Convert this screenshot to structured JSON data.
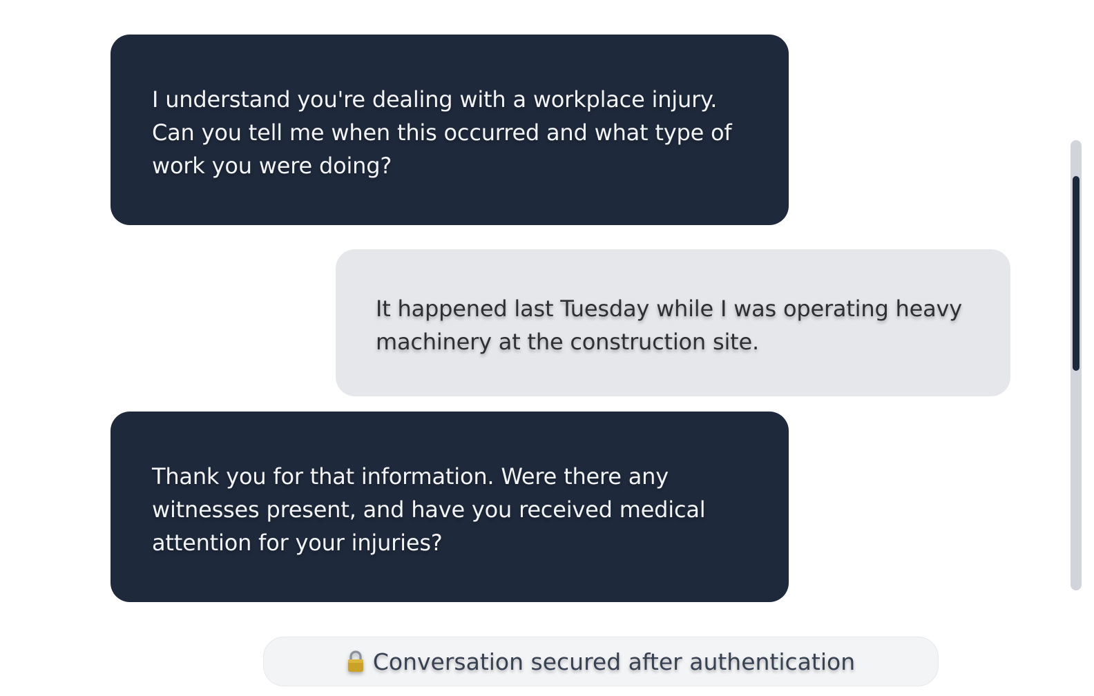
{
  "messages": [
    {
      "role": "agent",
      "text": "I understand you're dealing with a workplace injury. Can you tell me when this occurred and what type of work you were doing?"
    },
    {
      "role": "user",
      "text": "It happened last Tuesday while I was operating heavy machinery at the construction site."
    },
    {
      "role": "agent",
      "text": "Thank you for that information. Were there any witnesses present, and have you received medical attention for your injuries?"
    }
  ],
  "status": {
    "icon": "lock-icon",
    "text": "Conversation secured after authentication"
  },
  "colors": {
    "agent_bubble": "#1e293b",
    "user_bubble": "#e5e7eb",
    "status_pill": "#f3f4f6",
    "scroll_thumb": "#1e293b",
    "scroll_track": "#d1d5db"
  }
}
